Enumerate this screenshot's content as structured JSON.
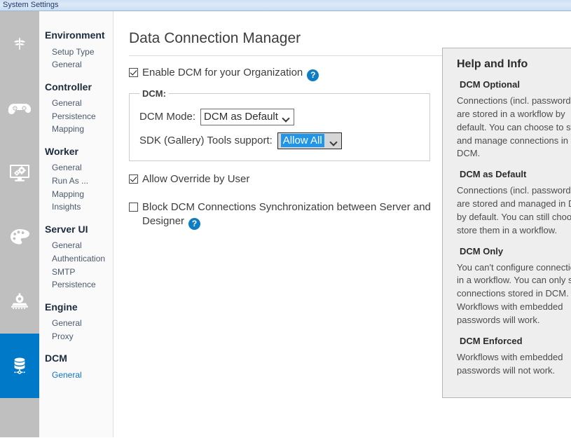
{
  "window": {
    "title": "System Settings"
  },
  "rail": [
    {
      "name": "environment",
      "icon": "leaf-icon",
      "active": false
    },
    {
      "name": "controller",
      "icon": "gamepad-icon",
      "active": false
    },
    {
      "name": "worker",
      "icon": "monitor-gears-icon",
      "active": false
    },
    {
      "name": "server-ui",
      "icon": "palette-icon",
      "active": false
    },
    {
      "name": "engine",
      "icon": "locomotive-icon",
      "active": false
    },
    {
      "name": "dcm",
      "icon": "database-icon",
      "active": true
    }
  ],
  "nav": {
    "groups": [
      {
        "title": "Environment",
        "items": [
          {
            "label": "Setup Type",
            "active": false
          },
          {
            "label": "General",
            "active": false
          }
        ]
      },
      {
        "title": "Controller",
        "items": [
          {
            "label": "General",
            "active": false
          },
          {
            "label": "Persistence",
            "active": false
          },
          {
            "label": "Mapping",
            "active": false
          }
        ]
      },
      {
        "title": "Worker",
        "items": [
          {
            "label": "General",
            "active": false
          },
          {
            "label": "Run As ...",
            "active": false
          },
          {
            "label": "Mapping",
            "active": false
          },
          {
            "label": "Insights",
            "active": false
          }
        ]
      },
      {
        "title": "Server UI",
        "items": [
          {
            "label": "General",
            "active": false
          },
          {
            "label": "Authentication",
            "active": false
          },
          {
            "label": "SMTP",
            "active": false
          },
          {
            "label": "Persistence",
            "active": false
          }
        ]
      },
      {
        "title": "Engine",
        "items": [
          {
            "label": "General",
            "active": false
          },
          {
            "label": "Proxy",
            "active": false
          }
        ]
      },
      {
        "title": "DCM",
        "items": [
          {
            "label": "General",
            "active": true
          }
        ]
      }
    ]
  },
  "main": {
    "page_title": "Data Connection Manager",
    "enable_dcm": {
      "label": "Enable DCM for your Organization",
      "checked": true,
      "help_glyph": "?"
    },
    "fieldset": {
      "legend": "DCM:",
      "mode": {
        "label": "DCM Mode:",
        "value": "DCM as Default"
      },
      "sdk_support": {
        "label": "SDK (Gallery) Tools support:",
        "value": "Allow All"
      }
    },
    "allow_override": {
      "label": "Allow Override by User",
      "checked": true
    },
    "block_sync": {
      "label": "Block DCM Connections Synchronization between Server and Designer",
      "checked": false,
      "help_glyph": "?"
    }
  },
  "help": {
    "title": "Help and Info",
    "sections": [
      {
        "heading": "DCM Optional",
        "body": "Connections (incl. passwords) are stored in a workflow by default. You can choose to store and manage connections in DCM."
      },
      {
        "heading": "DCM as Default",
        "body": "Connections (incl. passwords) are stored and managed in DCM by default. You can still choose to store them in a workflow."
      },
      {
        "heading": "DCM Only",
        "body": "You can't configure connections in a workflow. You can only select connections stored in DCM. Workflows with embedded passwords will work."
      },
      {
        "heading": "DCM Enforced",
        "body": "Workflows with embedded passwords will not work."
      }
    ]
  },
  "colors": {
    "accent": "#0079c8",
    "rail_bg": "#bfbfbf",
    "selection": "#2196e8",
    "help_bg": "#eeeeee"
  }
}
